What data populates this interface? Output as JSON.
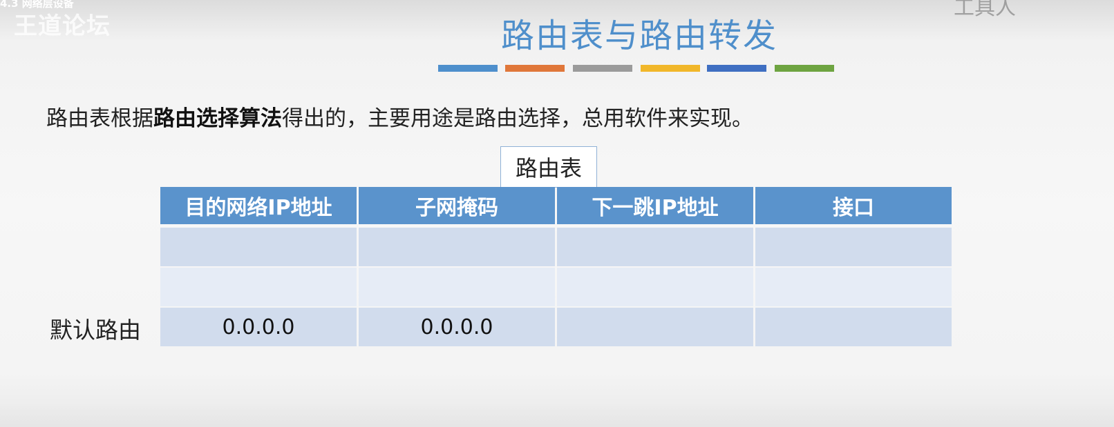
{
  "watermark": {
    "top_caption": "4.3 网络层设备",
    "brand": "王道论坛",
    "right_mark": "工具人"
  },
  "slide": {
    "title": "路由表与路由转发",
    "color_bars": [
      "#4e8fcc",
      "#e0773a",
      "#9b9b9b",
      "#f1b72a",
      "#3f6fc2",
      "#6ea441"
    ],
    "description": {
      "before": "路由表根据",
      "bold": "路由选择算法",
      "after": "得出的，主要用途是路由选择，总用软件来实现。"
    },
    "table": {
      "label": "路由表",
      "headers": [
        "目的网络IP地址",
        "子网掩码",
        "下一跳IP地址",
        "接口"
      ],
      "rows": [
        {
          "label": "",
          "cells": [
            "",
            "",
            "",
            ""
          ]
        },
        {
          "label": "",
          "cells": [
            "",
            "",
            "",
            ""
          ]
        },
        {
          "label": "默认路由",
          "cells": [
            "0.0.0.0",
            "0.0.0.0",
            "",
            ""
          ]
        }
      ]
    }
  }
}
